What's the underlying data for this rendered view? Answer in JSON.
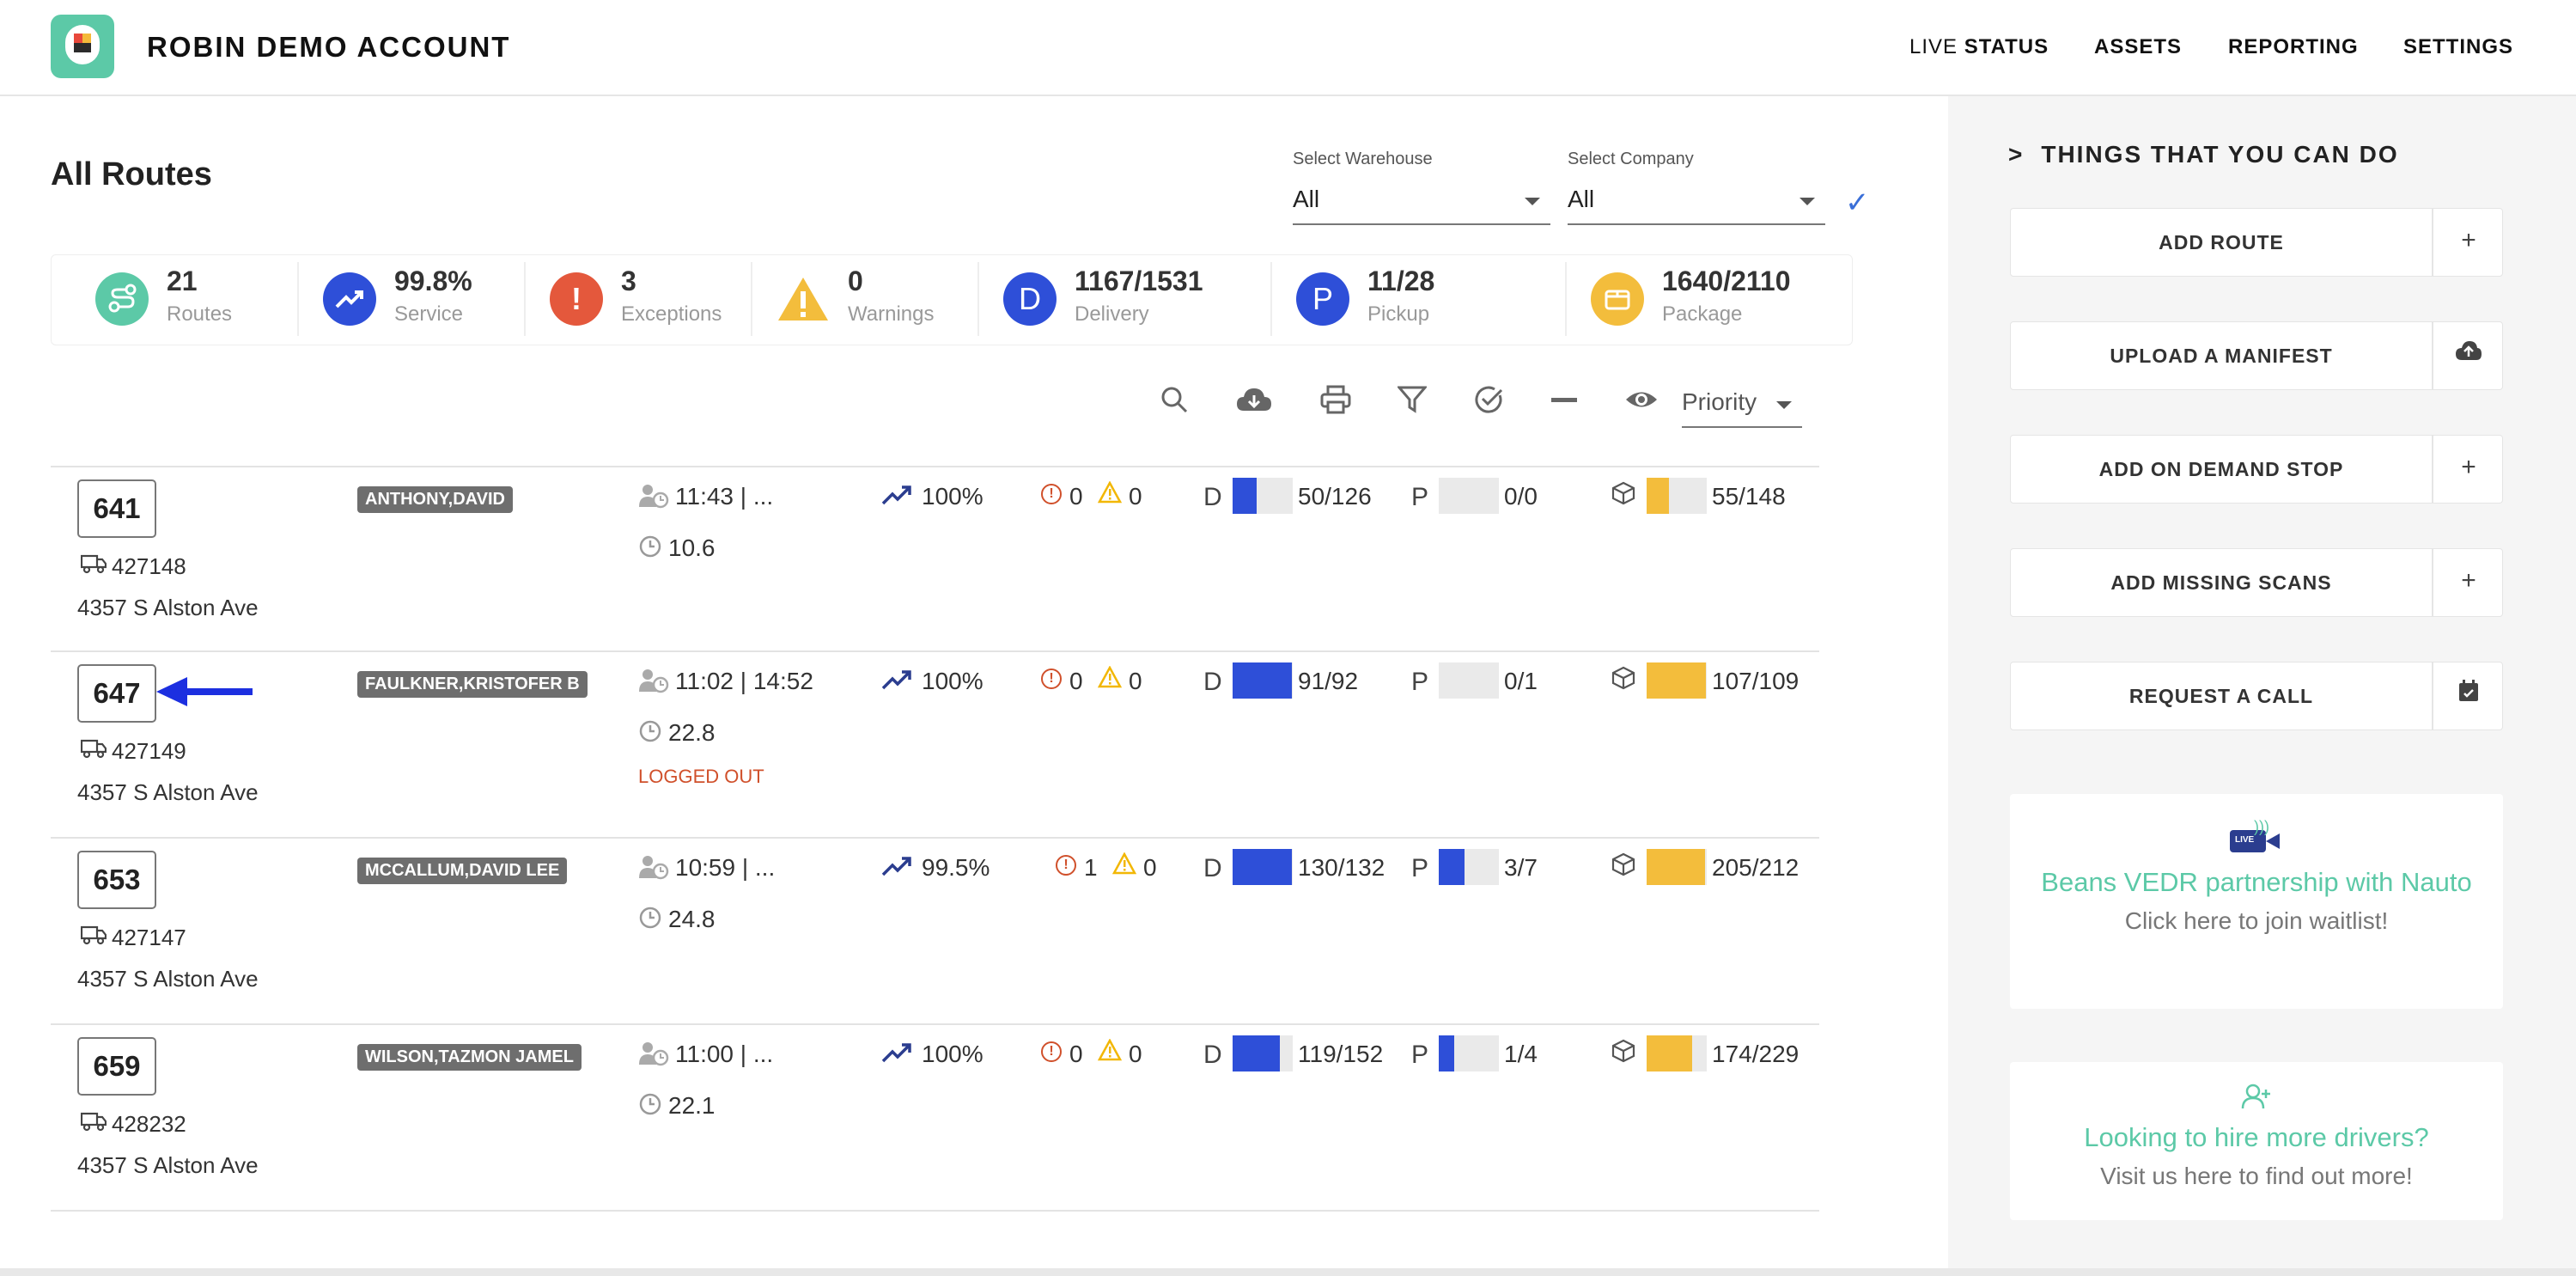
{
  "header": {
    "app_title": "ROBIN DEMO ACCOUNT",
    "nav_live_prefix": "LIVE",
    "nav_live_suffix": "STATUS",
    "nav_assets": "ASSETS",
    "nav_reporting": "REPORTING",
    "nav_settings": "SETTINGS"
  },
  "main": {
    "title": "All Routes",
    "warehouse_label": "Select Warehouse",
    "warehouse_value": "All",
    "company_label": "Select Company",
    "company_value": "All",
    "priority_value": "Priority"
  },
  "stats": [
    {
      "value": "21",
      "label": "Routes",
      "color": "#5cc9a7",
      "icon": "route-icon"
    },
    {
      "value": "99.8%",
      "label": "Service",
      "color": "#2e4fd8",
      "icon": "trend-icon"
    },
    {
      "value": "3",
      "label": "Exceptions",
      "color": "#e4583c",
      "icon": "exclamation-icon"
    },
    {
      "value": "0",
      "label": "Warnings",
      "color": "#f3bd3c",
      "icon": "warning-icon"
    },
    {
      "value": "1167/1531",
      "label": "Delivery",
      "color": "#2e4fd8",
      "icon": "D"
    },
    {
      "value": "11/28",
      "label": "Pickup",
      "color": "#2e4fd8",
      "icon": "P"
    },
    {
      "value": "1640/2110",
      "label": "Package",
      "color": "#f3bd3c",
      "icon": "package-icon"
    }
  ],
  "routes": [
    {
      "number": "641",
      "truck": "427148",
      "address": "4357 S Alston Ave",
      "driver": "ANTHONY,DAVID",
      "time": "11:43 | ...",
      "distance": "10.6",
      "status": "",
      "service": "100%",
      "exceptions": "0",
      "warnings": "0",
      "delivery": "50/126",
      "delivery_pct": 0.4,
      "pickup": "0/0",
      "pickup_pct": 0,
      "package": "55/148",
      "package_pct": 0.37
    },
    {
      "number": "647",
      "truck": "427149",
      "address": "4357 S Alston Ave",
      "driver": "FAULKNER,KRISTOFER B",
      "time": "11:02 | 14:52",
      "distance": "22.8",
      "status": "LOGGED OUT",
      "service": "100%",
      "exceptions": "0",
      "warnings": "0",
      "delivery": "91/92",
      "delivery_pct": 0.99,
      "pickup": "0/1",
      "pickup_pct": 0,
      "package": "107/109",
      "package_pct": 0.98
    },
    {
      "number": "653",
      "truck": "427147",
      "address": "4357 S Alston Ave",
      "driver": "MCCALLUM,DAVID LEE",
      "time": "10:59 | ...",
      "distance": "24.8",
      "status": "",
      "service": "99.5%",
      "exceptions": "1",
      "warnings": "0",
      "delivery": "130/132",
      "delivery_pct": 0.98,
      "pickup": "3/7",
      "pickup_pct": 0.43,
      "package": "205/212",
      "package_pct": 0.97
    },
    {
      "number": "659",
      "truck": "428232",
      "address": "4357 S Alston Ave",
      "driver": "WILSON,TAZMON JAMEL",
      "time": "11:00 | ...",
      "distance": "22.1",
      "status": "",
      "service": "100%",
      "exceptions": "0",
      "warnings": "0",
      "delivery": "119/152",
      "delivery_pct": 0.78,
      "pickup": "1/4",
      "pickup_pct": 0.25,
      "package": "174/229",
      "package_pct": 0.76
    }
  ],
  "side": {
    "heading": "THINGS THAT YOU CAN DO",
    "actions": [
      {
        "label": "ADD ROUTE",
        "icon": "plus-icon"
      },
      {
        "label": "UPLOAD A MANIFEST",
        "icon": "cloud-upload-icon"
      },
      {
        "label": "ADD ON DEMAND STOP",
        "icon": "plus-icon"
      },
      {
        "label": "ADD MISSING SCANS",
        "icon": "plus-icon"
      },
      {
        "label": "REQUEST A CALL",
        "icon": "calendar-icon"
      }
    ],
    "promo1_title": "Beans VEDR partnership with Nauto",
    "promo1_sub": "Click here to join waitlist!",
    "promo1_badge": "LIVE",
    "promo2_title": "Looking to hire more drivers?",
    "promo2_sub": "Visit us here to find out more!"
  },
  "colors": {
    "accent": "#5cc9a7",
    "blue": "#2e4fd8",
    "yellow": "#f3bd3c",
    "red": "#e4583c"
  }
}
